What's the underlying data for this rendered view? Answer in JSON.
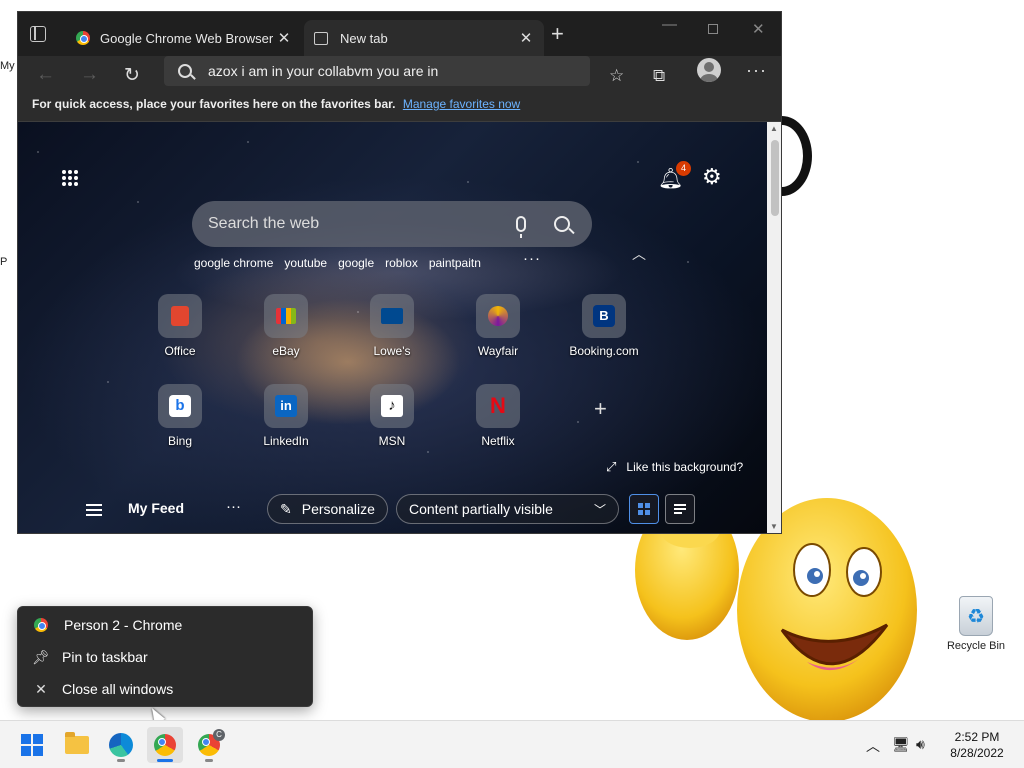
{
  "desktop": {
    "edge_text_1": "My",
    "edge_text_2": "P",
    "recycle_bin_label": "Recycle Bin",
    "emoji_name": "laughing-emoji"
  },
  "browser": {
    "tabs": [
      {
        "title": "Google Chrome Web Browser",
        "icon": "chrome-icon"
      },
      {
        "title": "New tab",
        "icon": "page-icon",
        "active": true
      }
    ],
    "address": "azox i am in your collabvm you are in",
    "favorites_bar": {
      "message": "For quick access, place your favorites here on the favorites bar.",
      "link": "Manage favorites now"
    },
    "ntp": {
      "notification_count": "4",
      "search_placeholder": "Search the web",
      "quick_searches": [
        "google chrome",
        "youtube",
        "google",
        "roblox",
        "paintpaitn"
      ],
      "tiles": [
        {
          "name": "Office",
          "icon": "office-icon",
          "color": "#e2462f"
        },
        {
          "name": "eBay",
          "icon": "ebay-icon",
          "color": "#e53238"
        },
        {
          "name": "Lowe's",
          "icon": "lowes-icon",
          "color": "#004990"
        },
        {
          "name": "Wayfair",
          "icon": "wayfair-icon",
          "color": "#7b189f"
        },
        {
          "name": "Booking.com",
          "icon": "booking-icon",
          "color": "#003580"
        },
        {
          "name": "Bing",
          "icon": "bing-icon",
          "color": "#ffffff"
        },
        {
          "name": "LinkedIn",
          "icon": "linkedin-icon",
          "color": "#0a66c2"
        },
        {
          "name": "MSN",
          "icon": "msn-icon",
          "color": "#ffffff"
        },
        {
          "name": "Netflix",
          "icon": "netflix-icon",
          "color": "#e50914"
        }
      ],
      "like_background": "Like this background?",
      "feed": {
        "my_feed": "My Feed",
        "personalize": "Personalize",
        "content_visibility": "Content partially visible"
      }
    }
  },
  "jumplist": {
    "items": [
      {
        "label": "Person 2 - Chrome",
        "icon": "chrome-icon"
      },
      {
        "label": "Pin to taskbar",
        "icon": "pin-icon"
      },
      {
        "label": "Close all windows",
        "icon": "close-icon"
      }
    ]
  },
  "taskbar": {
    "chrome_badge": "C",
    "time": "2:52 PM",
    "date": "8/28/2022"
  },
  "colors": {
    "accent": "#1a73e8",
    "link": "#6cb3ff",
    "badge": "#d83b01"
  }
}
